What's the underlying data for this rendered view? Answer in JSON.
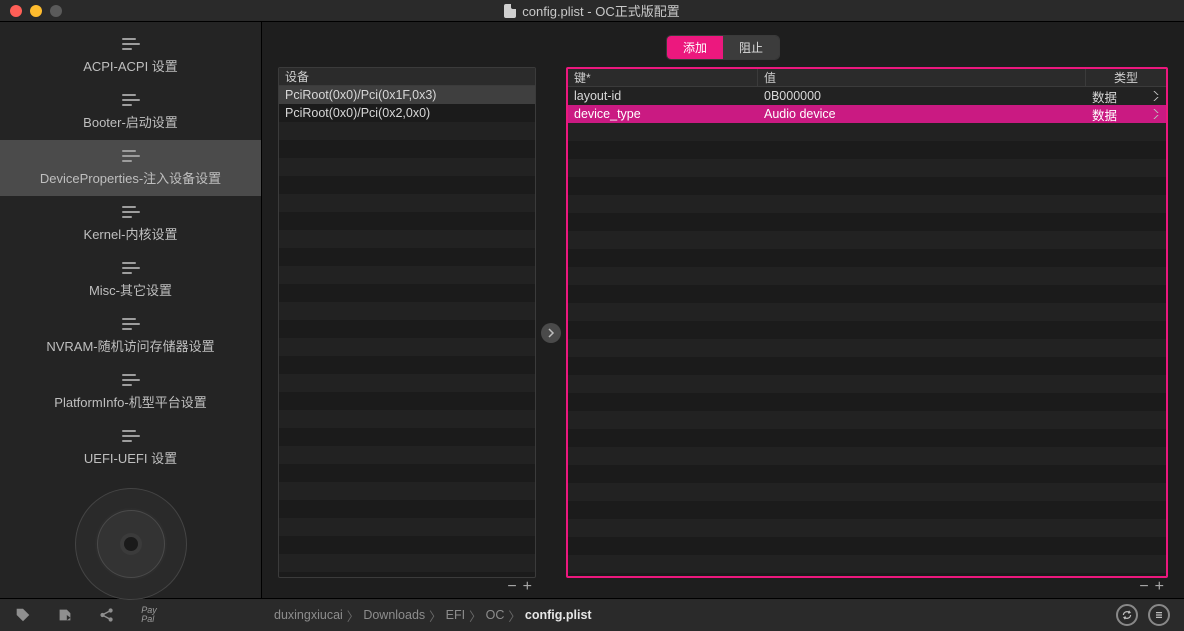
{
  "window": {
    "title": "config.plist - OC正式版配置"
  },
  "sidebar": {
    "items": [
      {
        "label": "ACPI-ACPI 设置"
      },
      {
        "label": "Booter-启动设置"
      },
      {
        "label": "DeviceProperties-注入设备设置"
      },
      {
        "label": "Kernel-内核设置"
      },
      {
        "label": "Misc-其它设置"
      },
      {
        "label": "NVRAM-随机访问存储器设置"
      },
      {
        "label": "PlatformInfo-机型平台设置"
      },
      {
        "label": "UEFI-UEFI 设置"
      }
    ],
    "active_index": 2
  },
  "tabs": {
    "items": [
      "添加",
      "阻止"
    ],
    "active_index": 0
  },
  "left_table": {
    "header": "设备",
    "rows": [
      "PciRoot(0x0)/Pci(0x1F,0x3)",
      "PciRoot(0x0)/Pci(0x2,0x0)"
    ],
    "selected_index": 0
  },
  "right_table": {
    "headers": {
      "key": "键*",
      "value": "值",
      "type": "类型"
    },
    "rows": [
      {
        "key": "layout-id",
        "value": "0B000000",
        "type": "数据"
      },
      {
        "key": "device_type",
        "value": "Audio device",
        "type": "数据"
      }
    ],
    "selected_index": 1
  },
  "footer_controls": {
    "minus": "−",
    "plus": "+"
  },
  "breadcrumbs": [
    "duxingxiucai",
    "Downloads",
    "EFI",
    "OC",
    "config.plist"
  ],
  "statusbar_icons": {
    "paypal": "Pay\nPal"
  }
}
